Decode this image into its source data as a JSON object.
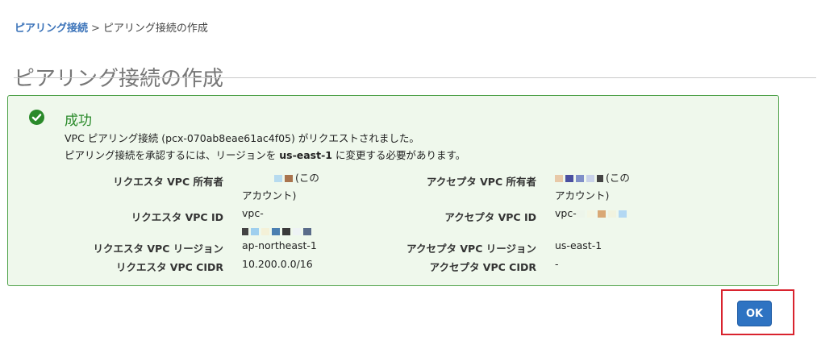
{
  "breadcrumb": {
    "parent": "ピアリング接続",
    "separator": ">",
    "current": "ピアリング接続の作成"
  },
  "page": {
    "title": "ピアリング接続の作成"
  },
  "alert": {
    "title": "成功",
    "message1": "VPC ピアリング接続 (pcx-070ab8eae61ac4f05) がリクエストされました。",
    "message2_prefix": "ピアリング接続を承認するには、リージョンを ",
    "message2_region": "us-east-1",
    "message2_suffix": " に変更する必要があります。",
    "icon": "check-circle-icon",
    "color_success": "#2a8a2a"
  },
  "details": {
    "requester": {
      "owner_label": "リクエスタ VPC 所有者",
      "owner_value_line1": "(この",
      "owner_value_line2": "アカウント)",
      "vpc_id_label": "リクエスタ VPC ID",
      "vpc_id_value": "vpc-",
      "region_label": "リクエスタ VPC リージョン",
      "region_value": "ap-northeast-1",
      "cidr_label": "リクエスタ VPC CIDR",
      "cidr_value": "10.200.0.0/16"
    },
    "accepter": {
      "owner_label": "アクセプタ VPC 所有者",
      "owner_value_line1": "(この",
      "owner_value_line2": "アカウント)",
      "vpc_id_label": "アクセプタ VPC ID",
      "vpc_id_value": "vpc-",
      "region_label": "アクセプタ VPC リージョン",
      "region_value": "us-east-1",
      "cidr_label": "アクセプタ VPC CIDR",
      "cidr_value": "-"
    }
  },
  "actions": {
    "ok_label": "OK"
  }
}
